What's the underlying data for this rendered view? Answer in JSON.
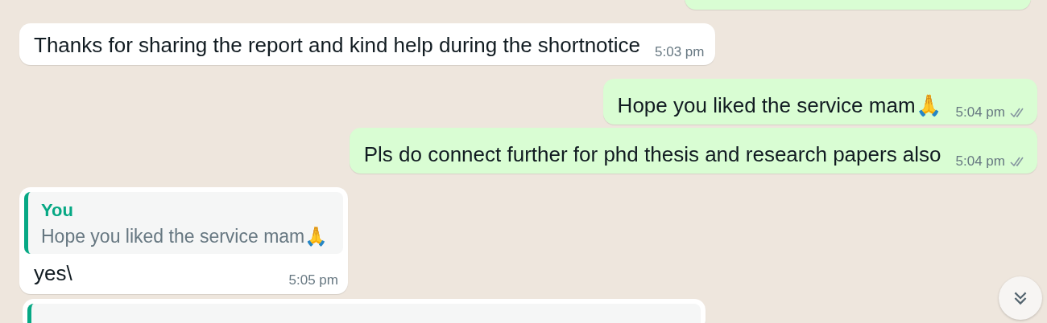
{
  "messages": [
    {
      "kind": "outgoing_cut"
    },
    {
      "kind": "incoming",
      "text": "Thanks for sharing the report and kind help during the shortnotice",
      "time": "5:03 pm"
    },
    {
      "kind": "outgoing",
      "text": "Hope you liked the service mam🙏",
      "time": "5:04 pm",
      "read": false
    },
    {
      "kind": "outgoing",
      "text": "Pls do connect further for phd thesis and research papers also",
      "time": "5:04 pm",
      "read": false
    },
    {
      "kind": "reply",
      "quote": {
        "author": "You",
        "text": "Hope you liked the service mam🙏"
      },
      "text": "yes\\",
      "time": "5:05 pm"
    },
    {
      "kind": "reply_cut"
    }
  ],
  "scroll_down_button": {
    "shown": true
  }
}
